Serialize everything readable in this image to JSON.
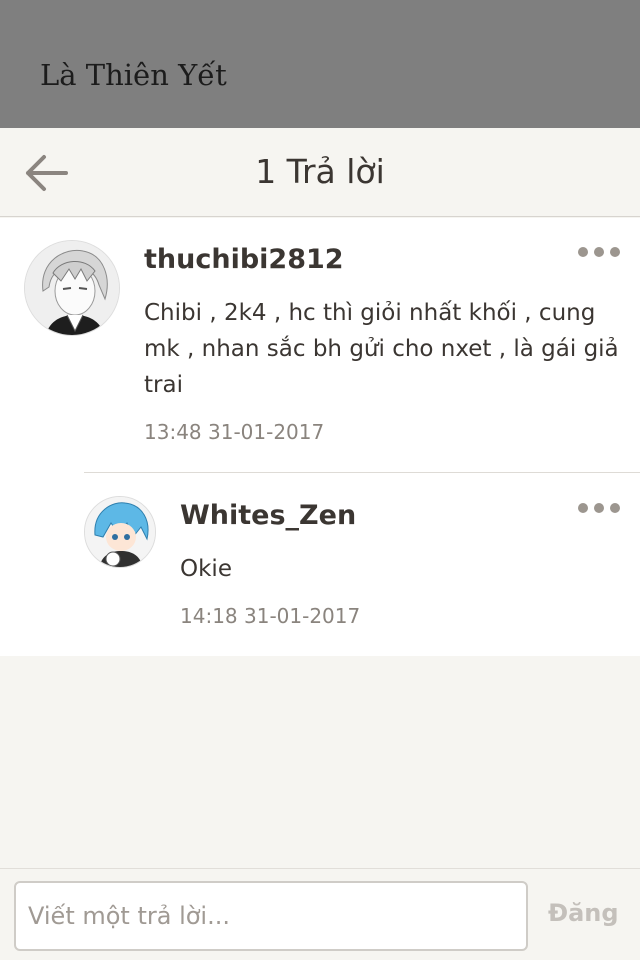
{
  "story": {
    "title": "Là Thiên Yết"
  },
  "header": {
    "title": "1 Trả lời",
    "back_icon": "arrow-left-icon"
  },
  "comment": {
    "author": "thuchibi2812",
    "text": "Chibi , 2k4 , hc thì giỏi nhất khối , cung mk , nhan sắc bh gửi cho nxet , là gái giả trai",
    "timestamp": "13:48 31-01-2017"
  },
  "reply": {
    "author": "Whites_Zen",
    "text": "Okie",
    "timestamp": "14:18 31-01-2017"
  },
  "composer": {
    "placeholder": "Viết một trả lời...",
    "value": "",
    "post_label": "Đăng"
  },
  "colors": {
    "top_strip": "#7f7f7f",
    "background": "#f6f5f1",
    "text": "#3b3632",
    "muted": "#8a847e",
    "disabled": "#c4c0bb"
  }
}
